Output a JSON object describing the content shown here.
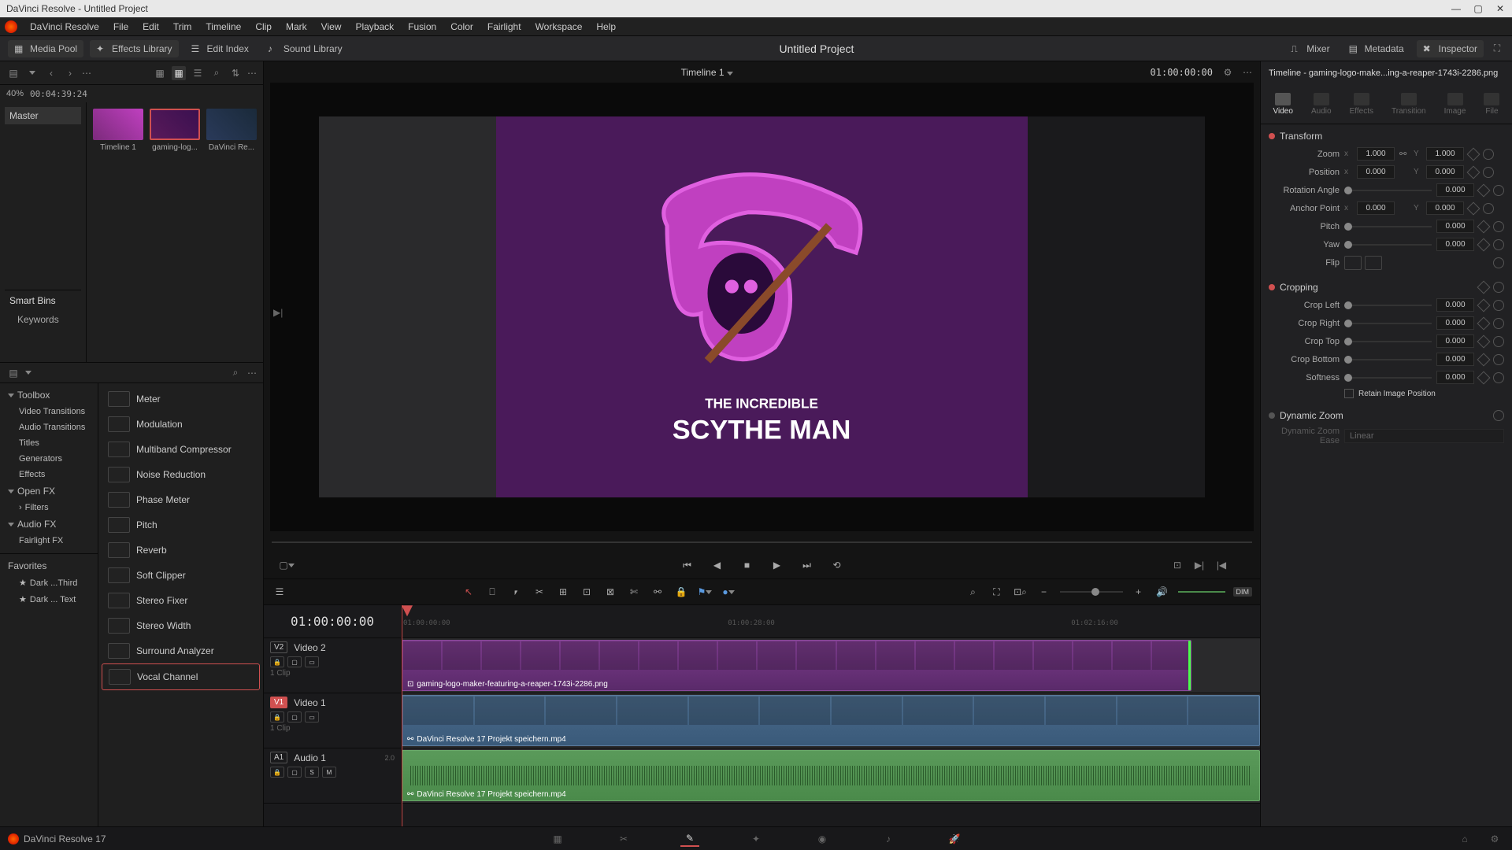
{
  "window": {
    "title": "DaVinci Resolve - Untitled Project"
  },
  "menu": [
    "DaVinci Resolve",
    "File",
    "Edit",
    "Trim",
    "Timeline",
    "Clip",
    "Mark",
    "View",
    "Playback",
    "Fusion",
    "Color",
    "Fairlight",
    "Workspace",
    "Help"
  ],
  "topToolbar": {
    "mediaPool": "Media Pool",
    "effectsLibrary": "Effects Library",
    "editIndex": "Edit Index",
    "soundLibrary": "Sound Library",
    "mixer": "Mixer",
    "metadata": "Metadata",
    "inspector": "Inspector"
  },
  "project": {
    "title": "Untitled Project"
  },
  "mediaPoolHeader": {
    "zoom": "40%",
    "duration": "00:04:39:24"
  },
  "masterBin": "Master",
  "smartBins": {
    "title": "Smart Bins",
    "items": [
      "Keywords"
    ]
  },
  "thumbs": [
    {
      "label": "Timeline 1"
    },
    {
      "label": "gaming-log..."
    },
    {
      "label": "DaVinci Re..."
    }
  ],
  "viewer": {
    "timelineName": "Timeline 1",
    "rightTC": "01:00:00:00",
    "logoTop": "THE INCREDIBLE",
    "logoMain": "SCYTHE MAN"
  },
  "fxCategories": {
    "toolbox": "Toolbox",
    "videoTransitions": "Video Transitions",
    "audioTransitions": "Audio Transitions",
    "titles": "Titles",
    "generators": "Generators",
    "effects": "Effects",
    "openfx": "Open FX",
    "filters": "Filters",
    "audiofx": "Audio FX",
    "fairlightfx": "Fairlight FX",
    "favorites": "Favorites",
    "fav1": "Dark ...Third",
    "fav2": "Dark ... Text"
  },
  "fxList": [
    "Meter",
    "Modulation",
    "Multiband Compressor",
    "Noise Reduction",
    "Phase Meter",
    "Pitch",
    "Reverb",
    "Soft Clipper",
    "Stereo Fixer",
    "Stereo Width",
    "Surround Analyzer",
    "Vocal Channel"
  ],
  "timeline": {
    "currentTC": "01:00:00:00",
    "ruler": [
      "01:00:00:00",
      "01:00:28:00",
      "01:02:16:00"
    ],
    "v2": {
      "tag": "V2",
      "name": "Video 2",
      "count": "1 Clip",
      "clipName": "gaming-logo-maker-featuring-a-reaper-1743i-2286.png"
    },
    "v1": {
      "tag": "V1",
      "name": "Video 1",
      "count": "1 Clip",
      "clipName": "DaVinci Resolve 17 Projekt speichern.mp4"
    },
    "a1": {
      "tag": "A1",
      "name": "Audio 1",
      "ch": "2.0",
      "clipName": "DaVinci Resolve 17 Projekt speichern.mp4",
      "s": "S",
      "m": "M"
    }
  },
  "inspector": {
    "clipName": "Timeline - gaming-logo-make...ing-a-reaper-1743i-2286.png",
    "tabs": [
      "Video",
      "Audio",
      "Effects",
      "Transition",
      "Image",
      "File"
    ],
    "transform": {
      "title": "Transform",
      "zoom": "Zoom",
      "zoomX": "1.000",
      "zoomY": "1.000",
      "position": "Position",
      "posX": "0.000",
      "posY": "0.000",
      "rotation": "Rotation Angle",
      "rotVal": "0.000",
      "anchor": "Anchor Point",
      "anchX": "0.000",
      "anchY": "0.000",
      "pitch": "Pitch",
      "pitchVal": "0.000",
      "yaw": "Yaw",
      "yawVal": "0.000",
      "flip": "Flip"
    },
    "cropping": {
      "title": "Cropping",
      "left": "Crop Left",
      "leftVal": "0.000",
      "right": "Crop Right",
      "rightVal": "0.000",
      "top": "Crop Top",
      "topVal": "0.000",
      "bottom": "Crop Bottom",
      "bottomVal": "0.000",
      "softness": "Softness",
      "softVal": "0.000",
      "retain": "Retain Image Position"
    },
    "dynamicZoom": {
      "title": "Dynamic Zoom",
      "easeLabel": "Dynamic Zoom Ease",
      "ease": "Linear"
    }
  },
  "bottom": {
    "version": "DaVinci Resolve 17",
    "dim": "DIM"
  }
}
